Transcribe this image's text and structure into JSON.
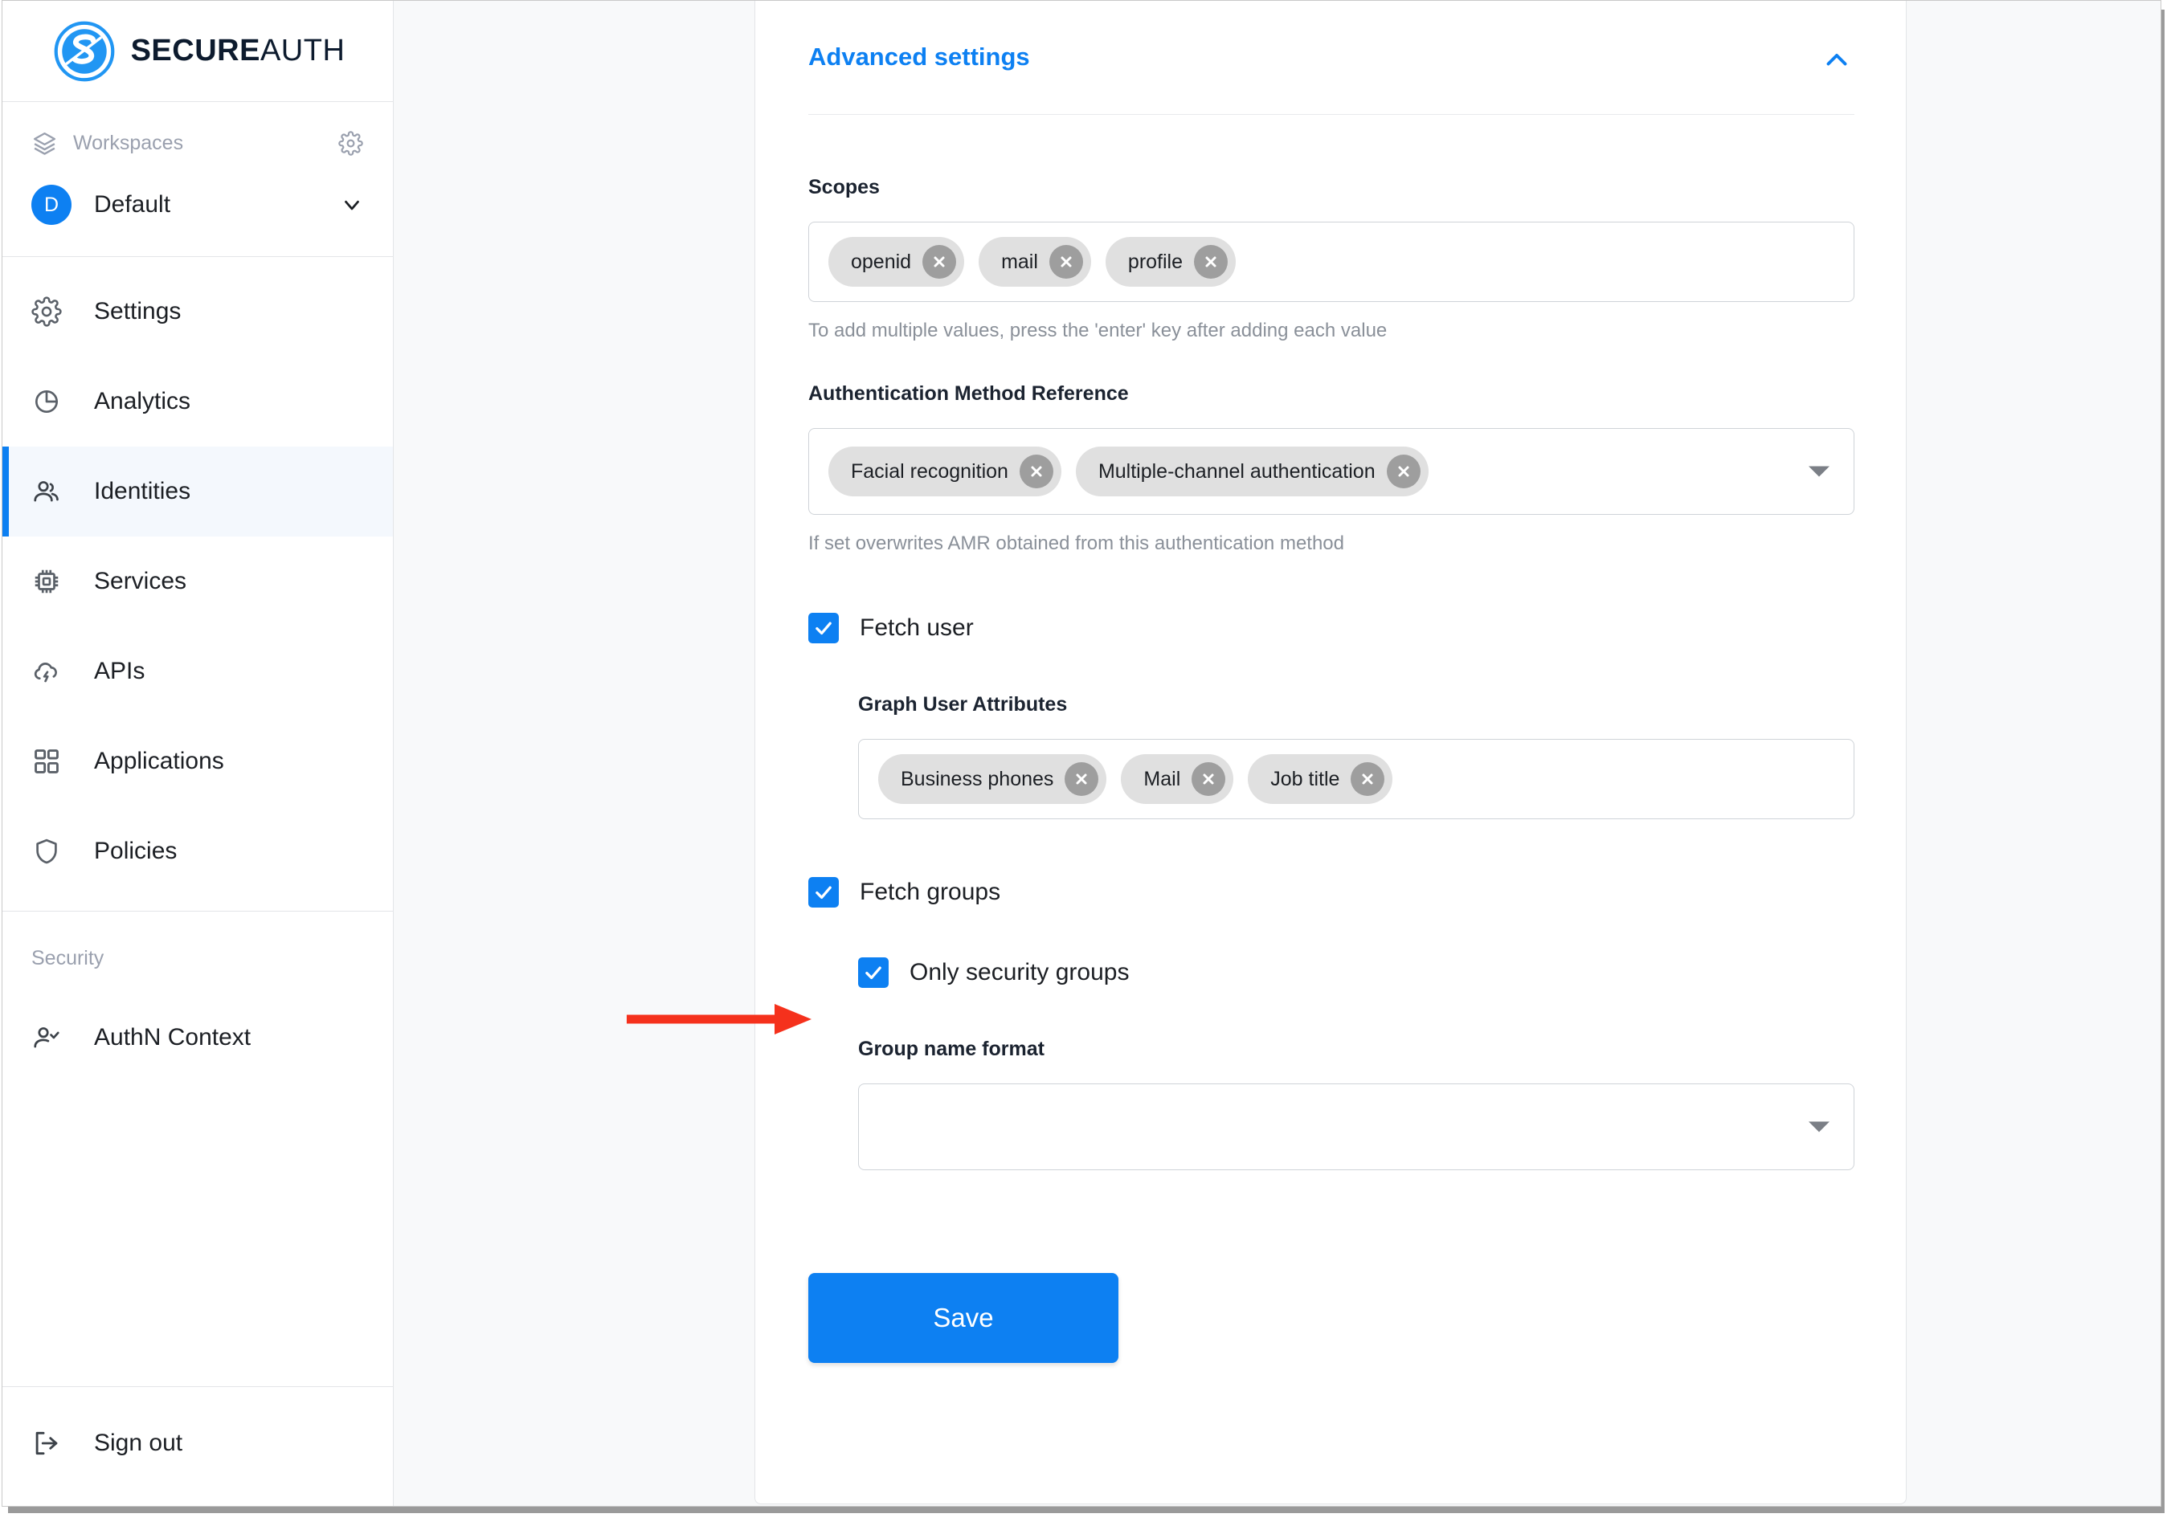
{
  "brand": {
    "name_bold": "SECURE",
    "name_light": "AUTH",
    "logo_icon": "secureauth-logo-icon"
  },
  "sidebar": {
    "workspaces": {
      "label": "Workspaces",
      "icon": "layers-icon",
      "gear_icon": "gear-icon"
    },
    "current_workspace": {
      "initial": "D",
      "name": "Default",
      "chevron_icon": "chevron-down-icon"
    },
    "nav_items": [
      {
        "label": "Settings",
        "icon": "gear-icon",
        "active": false
      },
      {
        "label": "Analytics",
        "icon": "pie-chart-icon",
        "active": false
      },
      {
        "label": "Identities",
        "icon": "users-icon",
        "active": true
      },
      {
        "label": "Services",
        "icon": "chip-icon",
        "active": false
      },
      {
        "label": "APIs",
        "icon": "cloud-bolt-icon",
        "active": false
      },
      {
        "label": "Applications",
        "icon": "grid-icon",
        "active": false
      },
      {
        "label": "Policies",
        "icon": "shield-icon",
        "active": false
      }
    ],
    "security_section_label": "Security",
    "security_items": [
      {
        "label": "AuthN Context",
        "icon": "user-check-icon"
      }
    ],
    "sign_out": {
      "label": "Sign out",
      "icon": "logout-icon"
    }
  },
  "main": {
    "header": {
      "title": "Advanced settings",
      "collapse_icon": "chevron-up-icon",
      "accent_color": "#0d80f2"
    },
    "scopes": {
      "label": "Scopes",
      "chips": [
        "openid",
        "mail",
        "profile"
      ],
      "hint": "To add multiple values, press the 'enter' key after adding each value"
    },
    "amr": {
      "label": "Authentication Method Reference",
      "chips": [
        "Facial recognition",
        "Multiple-channel authentication"
      ],
      "hint": "If set overwrites AMR obtained from this authentication method",
      "caret_icon": "caret-down-icon"
    },
    "fetch_user": {
      "label": "Fetch user",
      "checked": true
    },
    "graph_user_attributes": {
      "label": "Graph User Attributes",
      "chips": [
        "Business phones",
        "Mail",
        "Job title"
      ]
    },
    "fetch_groups": {
      "label": "Fetch groups",
      "checked": true
    },
    "only_security_groups": {
      "label": "Only security groups",
      "checked": true
    },
    "group_name_format": {
      "label": "Group name format",
      "value": "",
      "caret_icon": "caret-down-icon"
    },
    "save_button": {
      "label": "Save"
    }
  },
  "annotation": {
    "arrow_icon": "red-arrow-right-icon",
    "arrow_color": "#f5311c",
    "points_to": "Only security groups"
  }
}
